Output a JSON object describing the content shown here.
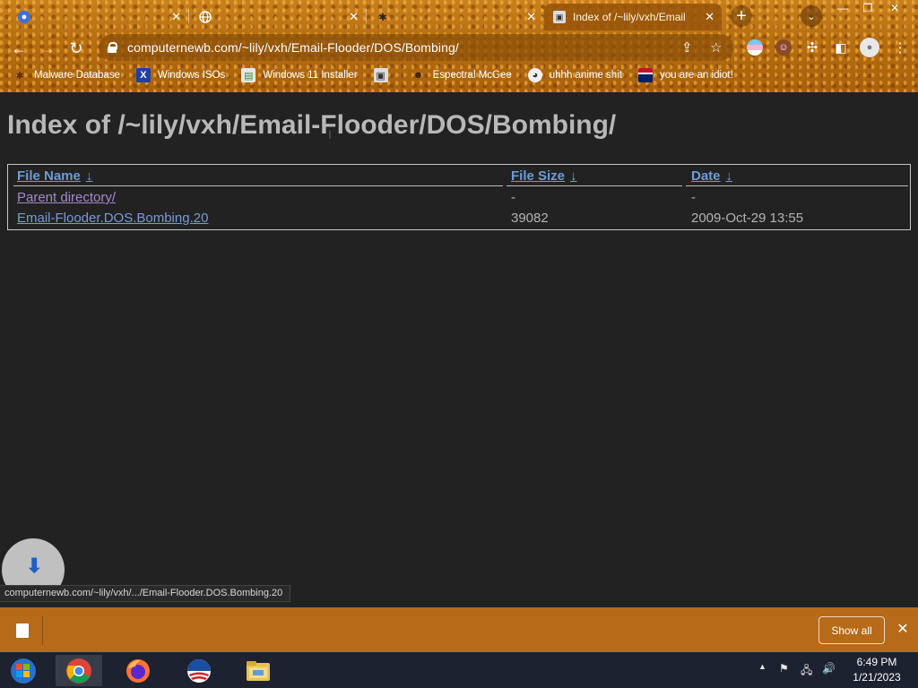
{
  "tabs": [
    {
      "title": "",
      "favicon": "paw-icon"
    },
    {
      "title": "",
      "favicon": "globe-icon"
    },
    {
      "title": "",
      "favicon": "paw-icon"
    },
    {
      "title": "Index of /~lily/vxh/Email",
      "favicon": "computer-icon",
      "active": true
    }
  ],
  "address_bar": {
    "url": "computernewb.com/~lily/vxh/Email-Flooder/DOS/Bombing/"
  },
  "bookmarks": [
    {
      "label": "Malware Database",
      "icon": "bug-icon"
    },
    {
      "label": "Windows ISOs",
      "icon": "x-logo-icon"
    },
    {
      "label": "Windows 11 Installer",
      "icon": "installer-icon"
    },
    {
      "label": "",
      "icon": "computer-icon"
    },
    {
      "label": "Espectral McGee",
      "icon": "face-icon"
    },
    {
      "label": "uhhh anime shit",
      "icon": "anime-icon"
    },
    {
      "label": "you are an idiot!",
      "icon": "flag-icon"
    }
  ],
  "page": {
    "heading": "Index of /~lily/vxh/Email-Flooder/DOS/Bombing/",
    "columns": [
      {
        "label": "File Name",
        "sort": "↓"
      },
      {
        "label": "File Size",
        "sort": "↓"
      },
      {
        "label": "Date",
        "sort": "↓"
      }
    ],
    "rows": [
      {
        "name": "Parent directory/",
        "size": "-",
        "date": "-"
      },
      {
        "name": "Email-Flooder.DOS.Bombing.20",
        "size": "39082",
        "date": "2009-Oct-29 13:55"
      }
    ]
  },
  "status_url": "computernewb.com/~lily/vxh/.../Email-Flooder.DOS.Bombing.20",
  "download_shelf": {
    "show_all_label": "Show all"
  },
  "taskbar": {
    "items": [
      "chrome-icon",
      "firefox-icon",
      "obama-icon",
      "file-explorer-icon"
    ],
    "time": "6:49 PM",
    "date": "1/21/2023"
  },
  "colors": {
    "accent": "#b76a17",
    "link": "#7a9ad2",
    "visited": "#a58ad0",
    "page_bg": "#222222"
  }
}
